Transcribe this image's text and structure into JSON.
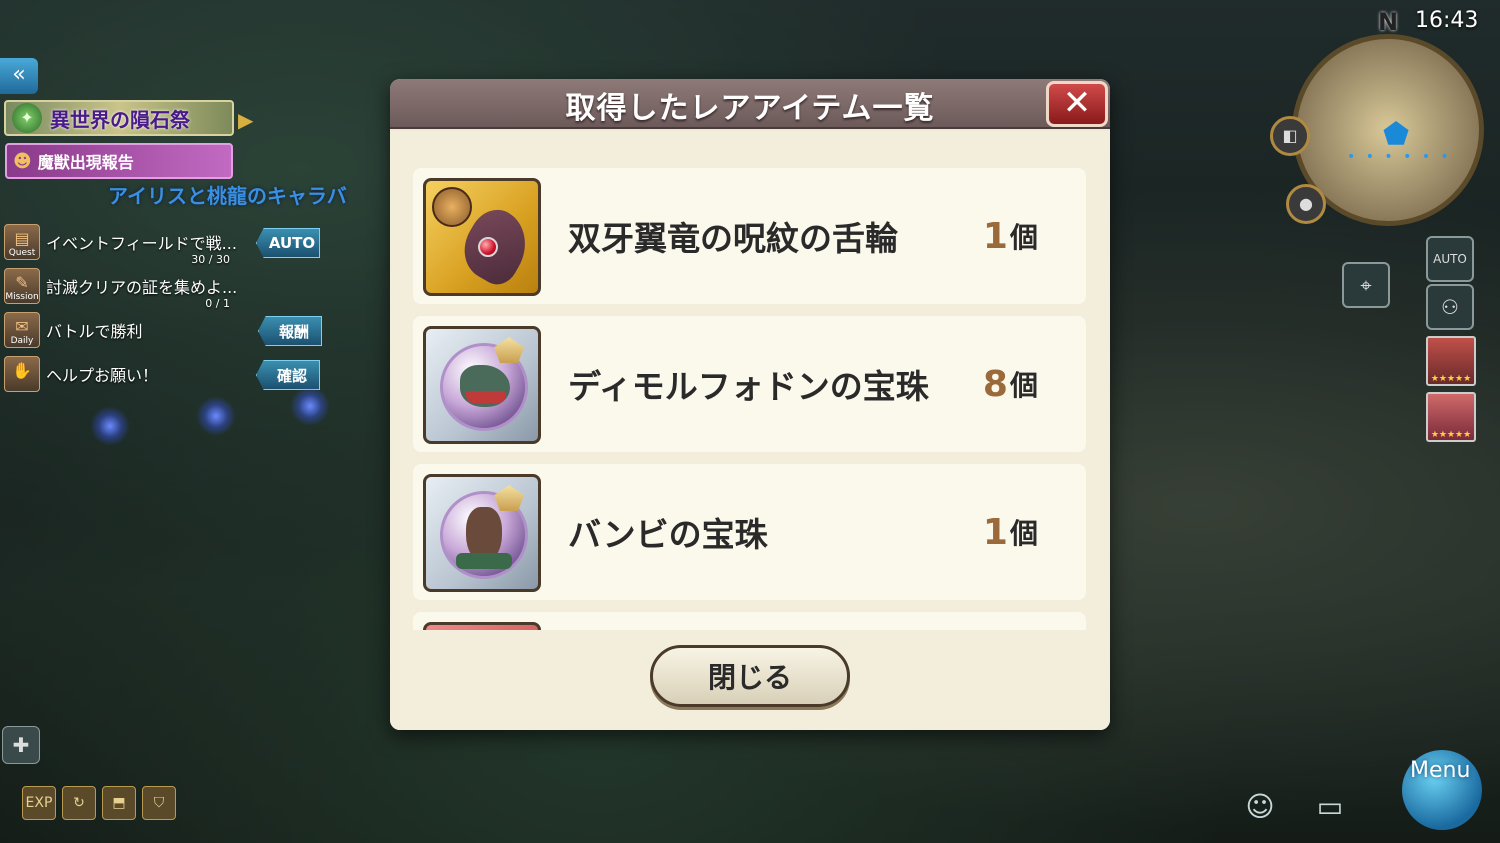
{
  "hud": {
    "time": "16:43",
    "compass": "N",
    "event_banner": "異世界の隕石祭",
    "monster_report": "魔獣出現報告",
    "scroll_notice": "アイリスと桃龍のキャラバ",
    "tasks": [
      {
        "category": "Quest",
        "text": "イベントフィールドで戦...",
        "progress": "30 / 30",
        "tag": "AUTO"
      },
      {
        "category": "Mission",
        "text": "討滅クリアの証を集めよ...",
        "progress": "0 / 1",
        "tag": ""
      },
      {
        "category": "Daily",
        "text": "バトルで勝利",
        "progress": "",
        "tag": "報酬"
      },
      {
        "category": "",
        "text": "ヘルプお願い！",
        "progress": "",
        "tag": "確認"
      }
    ],
    "bottom_left_icons": [
      "EXP"
    ],
    "auto_label": "AUTO",
    "menu_label": "Menu",
    "portrait_stars": "★★★★★"
  },
  "dialog": {
    "title": "取得したレアアイテム一覧",
    "close_button": "閉じる",
    "items": [
      {
        "name": "双牙翼竜の呪紋の舌輪",
        "count": "1",
        "unit": "個",
        "icon": "ring-gear-icon"
      },
      {
        "name": "ディモルフォドンの宝珠",
        "count": "8",
        "unit": "個",
        "icon": "dinosaur-orb-icon"
      },
      {
        "name": "バンビの宝珠",
        "count": "1",
        "unit": "個",
        "icon": "deer-orb-icon"
      }
    ]
  }
}
